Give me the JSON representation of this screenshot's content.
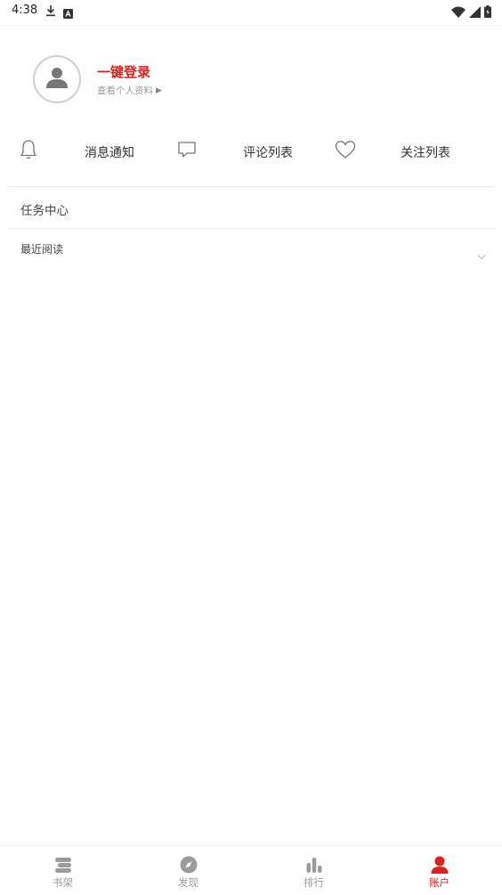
{
  "status_bar": {
    "time": "4:38",
    "icons": [
      "download-icon",
      "a-badge-icon",
      "wifi-icon",
      "signal-icon",
      "battery-icon"
    ]
  },
  "profile": {
    "login_title": "一键登录",
    "view_profile": "查看个人资料",
    "avatar_icon": "person-icon"
  },
  "actions": [
    {
      "label": "消息通知",
      "icon": "bell-icon"
    },
    {
      "label": "评论列表",
      "icon": "comment-icon"
    },
    {
      "label": "关注列表",
      "icon": "heart-icon"
    }
  ],
  "menu": {
    "task_center": "任务中心",
    "recent_reading": "最近阅读"
  },
  "bottom_nav": [
    {
      "label": "书架",
      "icon": "bookshelf-icon",
      "active": false
    },
    {
      "label": "发现",
      "icon": "compass-icon",
      "active": false
    },
    {
      "label": "排行",
      "icon": "ranking-icon",
      "active": false
    },
    {
      "label": "账户",
      "icon": "account-icon",
      "active": true
    }
  ],
  "colors": {
    "accent": "#e0201b",
    "inactive": "#9b9b9b",
    "divider": "#e9e9e9"
  }
}
